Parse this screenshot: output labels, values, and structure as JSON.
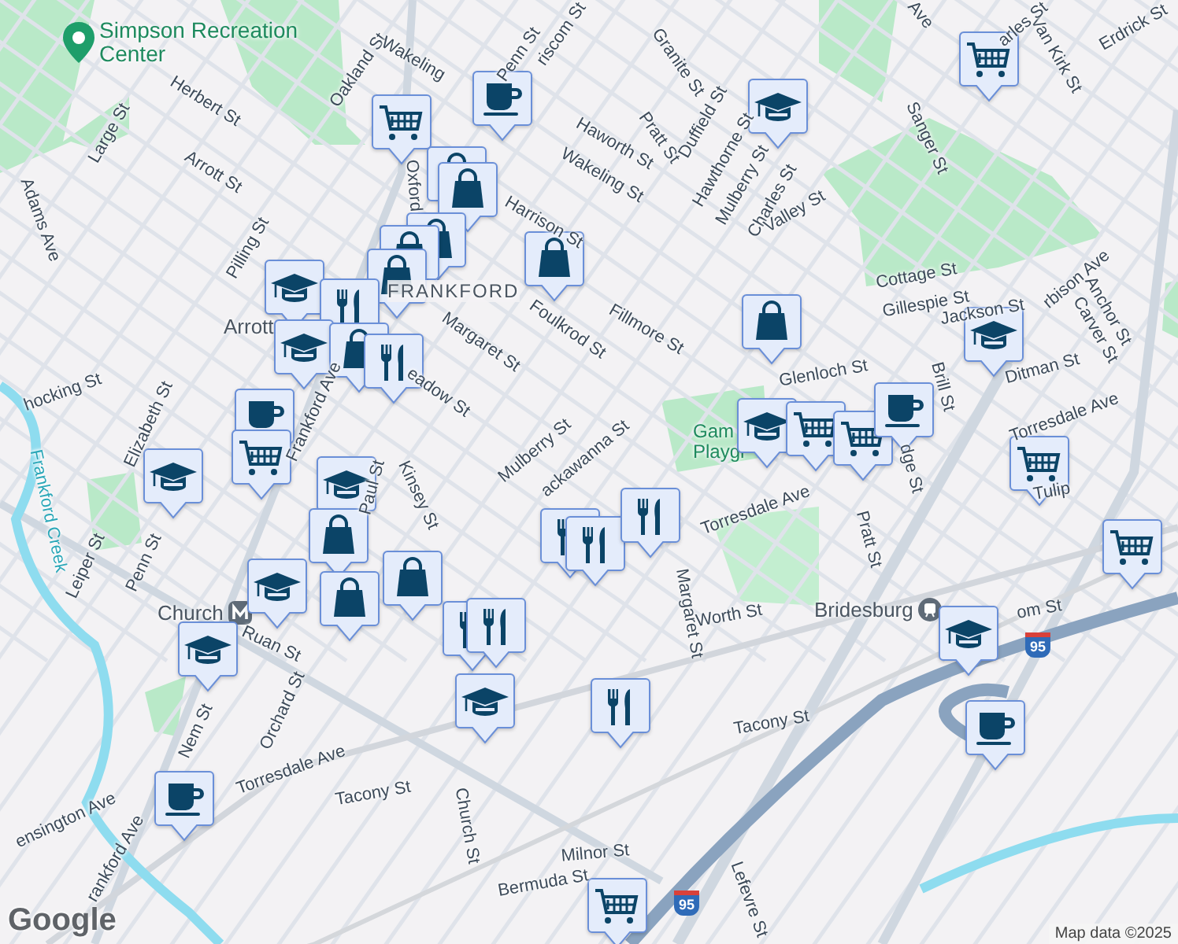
{
  "places": [
    {
      "label": "Simpson Recreation Center",
      "kind": "park"
    },
    {
      "label": "Church",
      "kind": "metro"
    },
    {
      "label": "Bridesburg",
      "kind": "train"
    },
    {
      "label": "Arrott",
      "kind": "plain"
    },
    {
      "label": "FRANKFORD",
      "kind": "district"
    },
    {
      "label": "Gam Playgr",
      "kind": "parkplain"
    }
  ],
  "streets": [
    "Oakland St",
    "Wakeling",
    "Penn St",
    "riscom St",
    "Herbert St",
    "Arrott St",
    "Large St",
    "Adams Ave",
    "Pilling St",
    "Oxford",
    "Harrison St",
    "Foulkrod St",
    "Margaret St",
    "eadow St",
    "Mulberry St",
    "ackawanna St",
    "Haworth St",
    "Wakeling St",
    "Pratt St",
    "Granite St",
    "Duffield St",
    "Hawthorne St",
    "Mulberry St",
    "Charles St",
    "Valley St",
    "Fillmore St",
    "Sanger St",
    "Van Kirk St",
    "Erdrick St",
    "arles St",
    "Ave",
    "Cottage St",
    "Gillespie St",
    "Jackson St",
    "rbison Ave",
    "Anchor St",
    "Carver St",
    "Ditman St",
    "Torresdale Ave",
    "Glenloch St",
    "Brill St",
    "Tulip",
    "dge St",
    "Pratt St",
    "Torresdale Ave",
    "Margaret St",
    "Worth St",
    "Tacony St",
    "Frankford Ave",
    "Paul St",
    "Kinsey St",
    "Elizabeth St",
    "hocking St",
    "Leiper St",
    "Penn St",
    "Ruan St",
    "Orchard St",
    "Nem St",
    "ensington Ave",
    "Torresdale Ave",
    "Tacony St",
    "Church St",
    "rankford Ave",
    "Milnor St",
    "Bermuda St",
    "Lefevre St",
    "om St"
  ],
  "waterways": [
    "Frankford Creek"
  ],
  "shields": [
    "95",
    "95"
  ],
  "markers": [
    {
      "kind": "cafe"
    },
    {
      "kind": "grocery"
    },
    {
      "kind": "shop"
    },
    {
      "kind": "shop"
    },
    {
      "kind": "shop"
    },
    {
      "kind": "shop"
    },
    {
      "kind": "shop"
    },
    {
      "kind": "shop"
    },
    {
      "kind": "school"
    },
    {
      "kind": "restaurant"
    },
    {
      "kind": "school"
    },
    {
      "kind": "shop"
    },
    {
      "kind": "restaurant"
    },
    {
      "kind": "cafe"
    },
    {
      "kind": "grocery"
    },
    {
      "kind": "school"
    },
    {
      "kind": "school"
    },
    {
      "kind": "shop"
    },
    {
      "kind": "shop"
    },
    {
      "kind": "school"
    },
    {
      "kind": "shop"
    },
    {
      "kind": "school"
    },
    {
      "kind": "restaurant"
    },
    {
      "kind": "restaurant"
    },
    {
      "kind": "school"
    },
    {
      "kind": "restaurant"
    },
    {
      "kind": "restaurant"
    },
    {
      "kind": "restaurant"
    },
    {
      "kind": "restaurant"
    },
    {
      "kind": "cafe"
    },
    {
      "kind": "grocery"
    },
    {
      "kind": "school"
    },
    {
      "kind": "shop"
    },
    {
      "kind": "school"
    },
    {
      "kind": "grocery"
    },
    {
      "kind": "grocery"
    },
    {
      "kind": "cafe"
    },
    {
      "kind": "school"
    },
    {
      "kind": "grocery"
    },
    {
      "kind": "grocery"
    },
    {
      "kind": "grocery"
    },
    {
      "kind": "school"
    },
    {
      "kind": "cafe"
    }
  ],
  "logo": "Google",
  "attribution": "Map data ©2025"
}
